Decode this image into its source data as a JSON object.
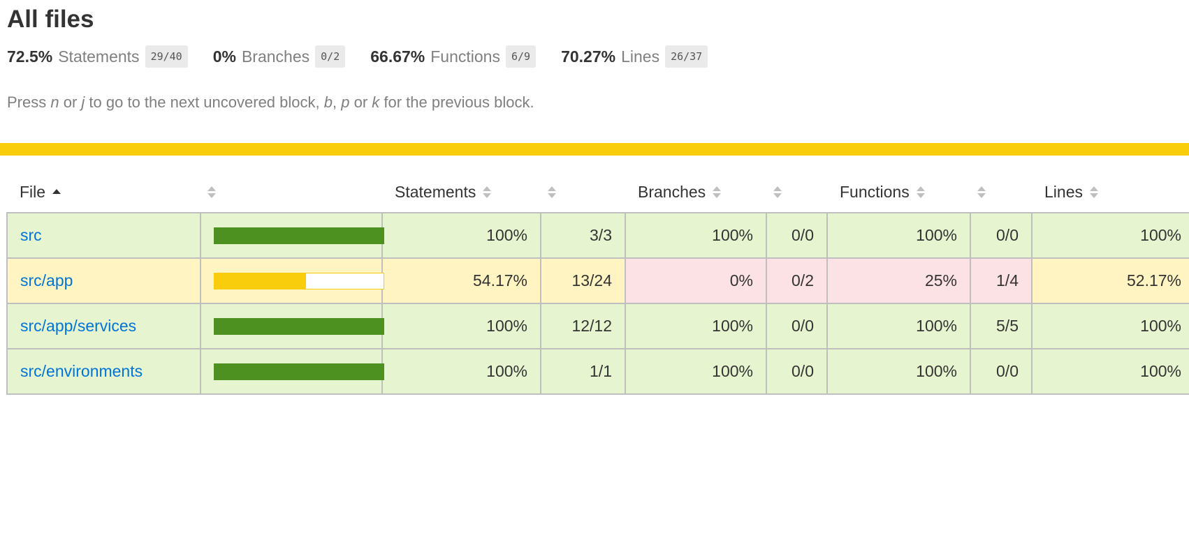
{
  "page_title": "All files",
  "summary": [
    {
      "pct": "72.5%",
      "label": "Statements",
      "frac": "29/40"
    },
    {
      "pct": "0%",
      "label": "Branches",
      "frac": "0/2"
    },
    {
      "pct": "66.67%",
      "label": "Functions",
      "frac": "6/9"
    },
    {
      "pct": "70.27%",
      "label": "Lines",
      "frac": "26/37"
    }
  ],
  "help": {
    "t1": "Press ",
    "k1": "n",
    "t2": " or ",
    "k2": "j",
    "t3": " to go to the next uncovered block, ",
    "k3": "b",
    "t4": ", ",
    "k4": "p",
    "t5": " or ",
    "k5": "k",
    "t6": " for the previous block."
  },
  "status_color": "#f9cd0b",
  "headers": {
    "file": "File",
    "statements": "Statements",
    "branches": "Branches",
    "functions": "Functions",
    "lines": "Lines"
  },
  "rows": [
    {
      "file": "src",
      "level": "high",
      "fill": 1.0,
      "st_pct": "100%",
      "st_frac": "3/3",
      "br_pct": "100%",
      "br_frac": "0/0",
      "br_level": "high",
      "fn_pct": "100%",
      "fn_frac": "0/0",
      "fn_level": "high",
      "ln_pct": "100%"
    },
    {
      "file": "src/app",
      "level": "medium",
      "fill": 0.5417,
      "st_pct": "54.17%",
      "st_frac": "13/24",
      "br_pct": "0%",
      "br_frac": "0/2",
      "br_level": "low",
      "fn_pct": "25%",
      "fn_frac": "1/4",
      "fn_level": "low",
      "ln_pct": "52.17%"
    },
    {
      "file": "src/app/services",
      "level": "high",
      "fill": 1.0,
      "st_pct": "100%",
      "st_frac": "12/12",
      "br_pct": "100%",
      "br_frac": "0/0",
      "br_level": "high",
      "fn_pct": "100%",
      "fn_frac": "5/5",
      "fn_level": "high",
      "ln_pct": "100%"
    },
    {
      "file": "src/environments",
      "level": "high",
      "fill": 1.0,
      "st_pct": "100%",
      "st_frac": "1/1",
      "br_pct": "100%",
      "br_frac": "0/0",
      "br_level": "high",
      "fn_pct": "100%",
      "fn_frac": "0/0",
      "fn_level": "high",
      "ln_pct": "100%"
    }
  ]
}
